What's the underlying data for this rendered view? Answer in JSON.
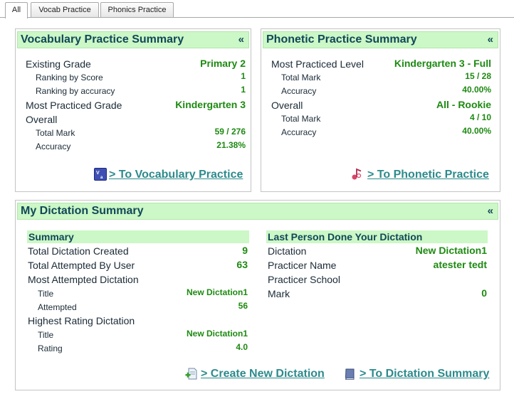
{
  "tabs": [
    {
      "label": "All",
      "active": true
    },
    {
      "label": "Vocab Practice",
      "active": false
    },
    {
      "label": "Phonics Practice",
      "active": false
    }
  ],
  "collapse_glyph": "«",
  "vocab": {
    "title": "Vocabulary Practice Summary",
    "existing_grade_label": "Existing Grade",
    "existing_grade_value": "Primary 2",
    "ranking_score_label": "Ranking by Score",
    "ranking_score_value": "1",
    "ranking_accuracy_label": "Ranking by accuracy",
    "ranking_accuracy_value": "1",
    "most_practiced_label": "Most Practiced Grade",
    "most_practiced_value": "Kindergarten 3",
    "overall_label": "Overall",
    "total_mark_label": "Total Mark",
    "total_mark_value": "59 / 276",
    "accuracy_label": "Accuracy",
    "accuracy_value": "21.38%",
    "link_label": "> To Vocabulary Practice",
    "link_icon": "vocab-book-icon"
  },
  "phonetic": {
    "title": "Phonetic Practice Summary",
    "most_practiced_label": "Most Practiced Level",
    "most_practiced_value": "Kindergarten 3 - Full",
    "level_total_mark_label": "Total Mark",
    "level_total_mark_value": "15 / 28",
    "level_accuracy_label": "Accuracy",
    "level_accuracy_value": "40.00%",
    "overall_label": "Overall",
    "overall_value": "All - Rookie",
    "overall_total_mark_label": "Total Mark",
    "overall_total_mark_value": "4 / 10",
    "overall_accuracy_label": "Accuracy",
    "overall_accuracy_value": "40.00%",
    "link_label": "> To Phonetic Practice",
    "link_icon": "music-note-icon"
  },
  "dictation": {
    "title": "My Dictation Summary",
    "summary_header": "Summary",
    "total_created_label": "Total Dictation Created",
    "total_created_value": "9",
    "total_attempted_label": "Total Attempted By User",
    "total_attempted_value": "63",
    "most_attempted_label": "Most Attempted Dictation",
    "most_attempted_title_label": "Title",
    "most_attempted_title_value": "New Dictation1",
    "attempted_label": "Attempted",
    "attempted_value": "56",
    "highest_rating_label": "Highest Rating Dictation",
    "highest_rating_title_label": "Title",
    "highest_rating_title_value": "New Dictation1",
    "rating_label": "Rating",
    "rating_value": "4.0",
    "last_person_header": "Last Person Done Your Dictation",
    "dictation_label": "Dictation",
    "dictation_value": "New Dictation1",
    "practicer_name_label": "Practicer Name",
    "practicer_name_value": "atester tedt",
    "practicer_school_label": "Practicer School",
    "practicer_school_value": "",
    "mark_label": "Mark",
    "mark_value": "0",
    "create_link_label": "> Create New Dictation",
    "create_link_icon": "new-document-icon",
    "summary_link_label": "> To Dictation Summary",
    "summary_link_icon": "book-icon"
  }
}
